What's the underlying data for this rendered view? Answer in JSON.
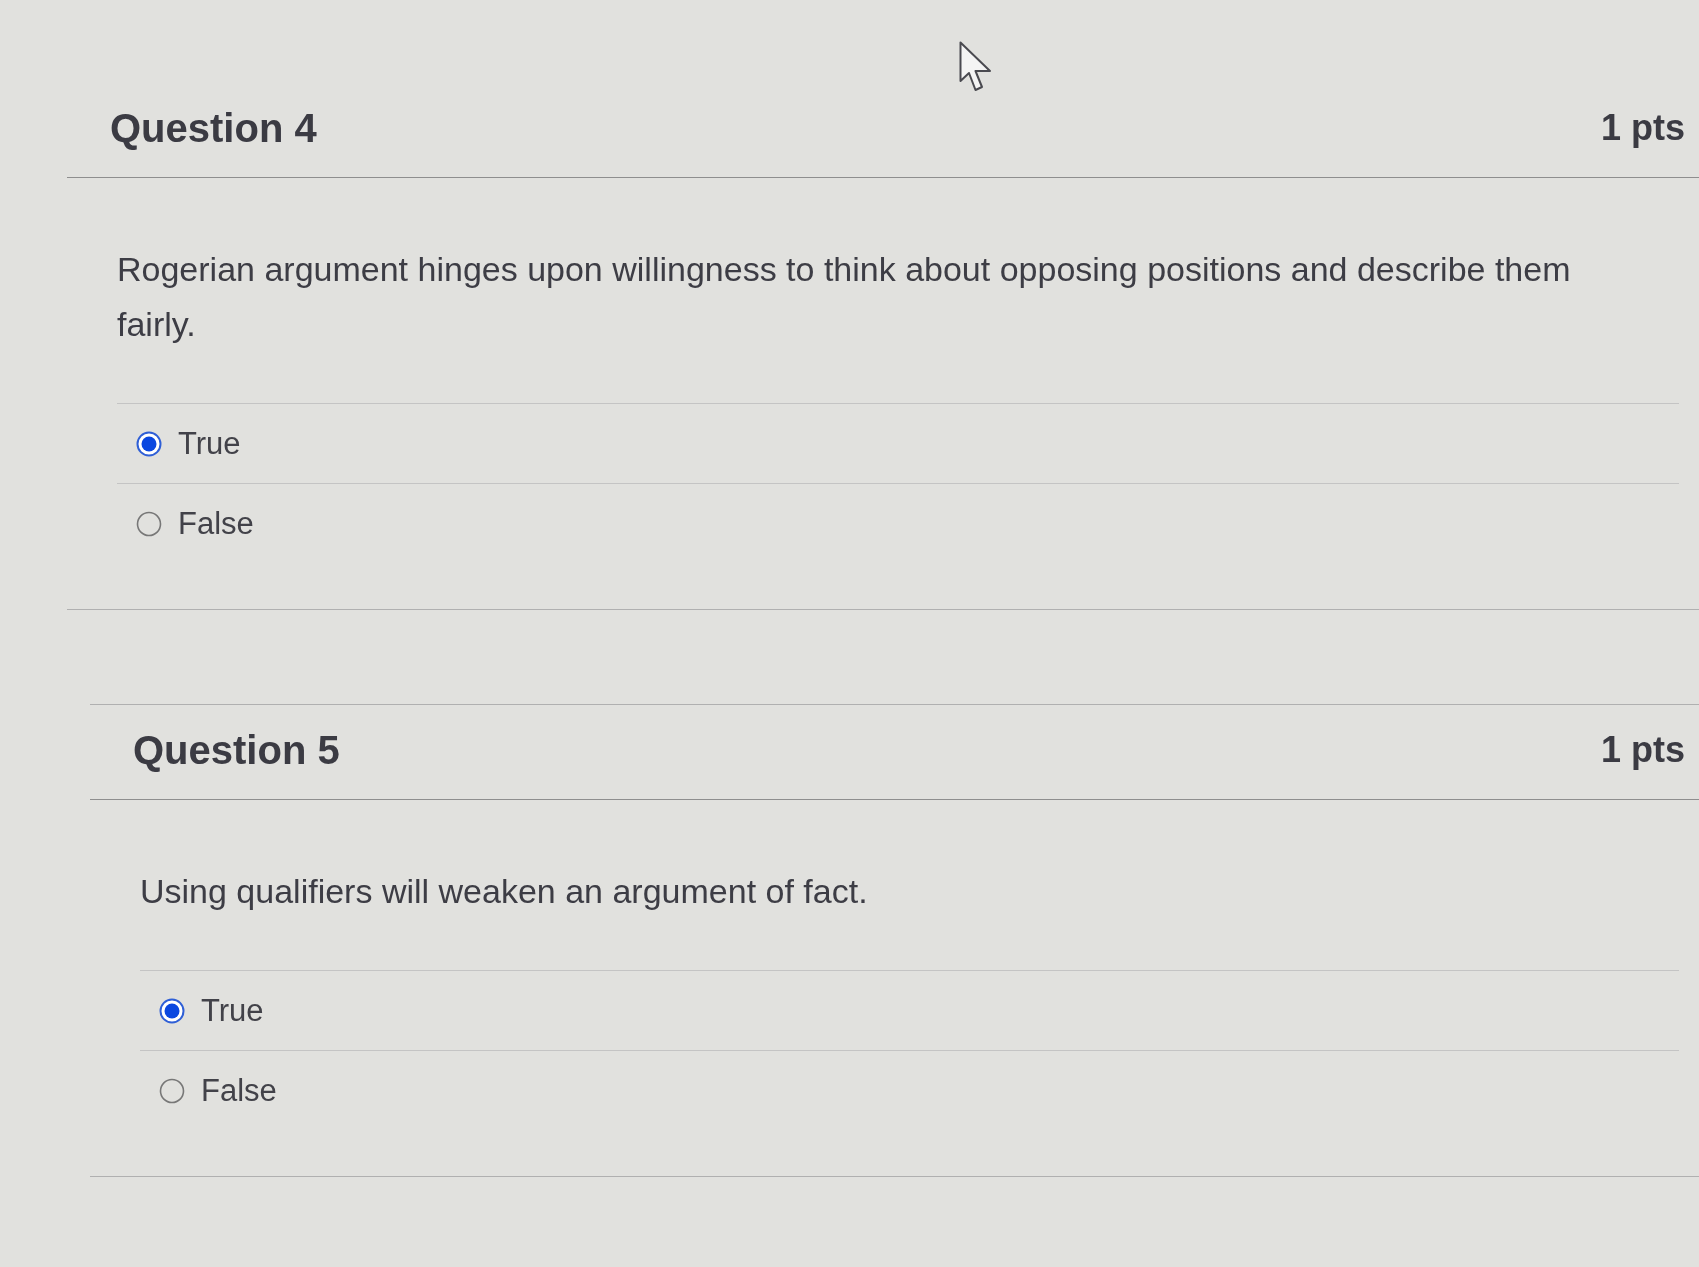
{
  "questions": [
    {
      "title": "Question 4",
      "points": "1 pts",
      "text": "Rogerian argument hinges upon willingness to think about opposing positions and describe them fairly.",
      "answers": [
        {
          "label": "True",
          "selected": true
        },
        {
          "label": "False",
          "selected": false
        }
      ]
    },
    {
      "title": "Question 5",
      "points": "1 pts",
      "text": "Using qualifiers will weaken an argument of fact.",
      "answers": [
        {
          "label": "True",
          "selected": true
        },
        {
          "label": "False",
          "selected": false
        }
      ]
    }
  ]
}
